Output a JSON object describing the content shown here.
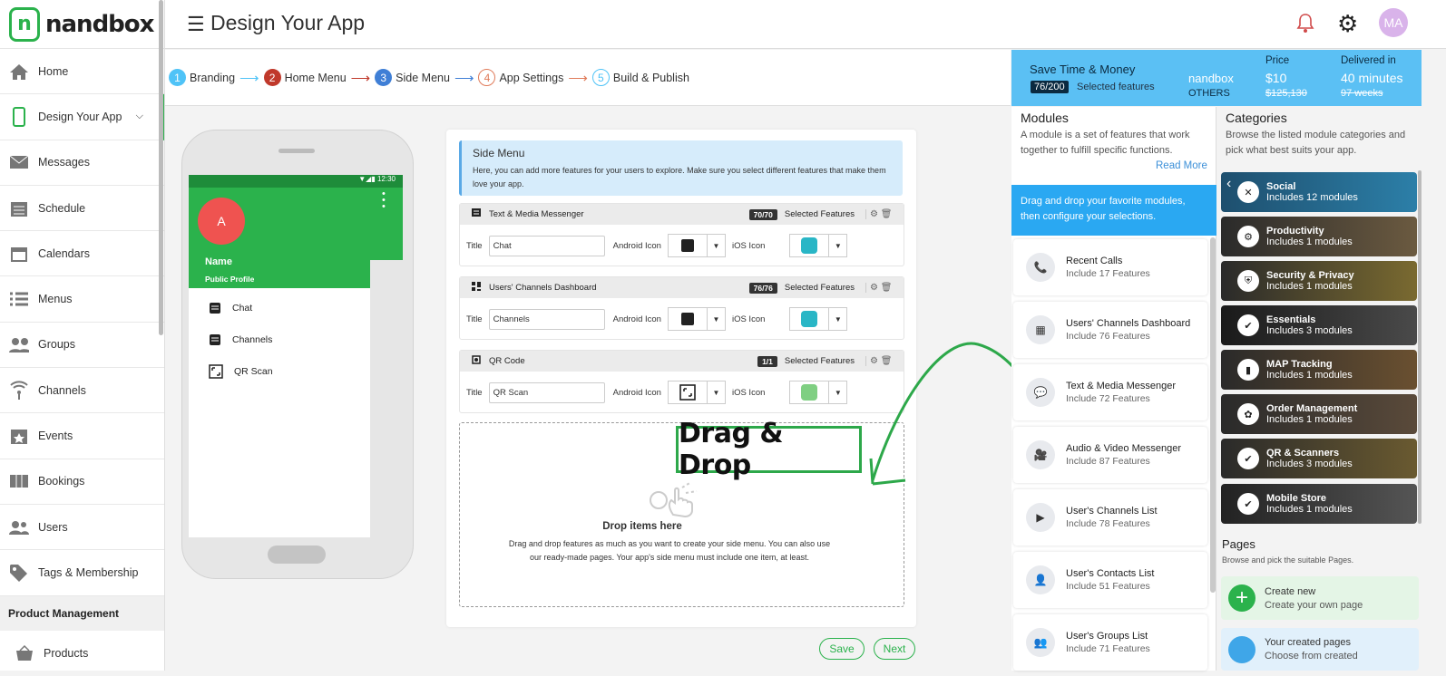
{
  "app": {
    "logo_mark": "n",
    "logo_text": "nandbox",
    "page_title": "Design Your App",
    "avatar_initials": "MA"
  },
  "sidebar": {
    "items": [
      {
        "label": "Home",
        "icon": "home-icon"
      },
      {
        "label": "Design Your App",
        "icon": "phone-icon",
        "active": true
      },
      {
        "label": "Messages",
        "icon": "envelope-icon"
      },
      {
        "label": "Schedule",
        "icon": "schedule-icon"
      },
      {
        "label": "Calendars",
        "icon": "calendar-icon"
      },
      {
        "label": "Menus",
        "icon": "list-icon"
      },
      {
        "label": "Groups",
        "icon": "groups-icon"
      },
      {
        "label": "Channels",
        "icon": "broadcast-icon"
      },
      {
        "label": "Events",
        "icon": "event-icon"
      },
      {
        "label": "Bookings",
        "icon": "booking-icon"
      },
      {
        "label": "Users",
        "icon": "users-icon"
      },
      {
        "label": "Tags & Membership",
        "icon": "tag-icon"
      }
    ],
    "section": "Product Management",
    "section_items": [
      {
        "label": "Products",
        "icon": "basket-icon"
      }
    ]
  },
  "steps": [
    {
      "num": "1",
      "label": "Branding",
      "color": "#4fc3f7"
    },
    {
      "num": "2",
      "label": "Home Menu",
      "color": "#c0392b"
    },
    {
      "num": "3",
      "label": "Side Menu",
      "color": "#3f7fd6"
    },
    {
      "num": "4",
      "label": "App Settings",
      "color": "#e07b5a"
    },
    {
      "num": "5",
      "label": "Build & Publish",
      "color": "#4fc3f7"
    }
  ],
  "phone": {
    "time": "12:30",
    "avatar": "A",
    "name": "Name",
    "profile": "Public Profile",
    "items": [
      "Chat",
      "Channels",
      "QR Scan"
    ]
  },
  "editor": {
    "intro_title": "Side Menu",
    "intro_desc": "Here, you can add more features for your users to explore. Make sure you select different features that make them love your app.",
    "selected_label": "Selected Features",
    "title_label": "Title",
    "android_label": "Android Icon",
    "ios_label": "iOS Icon",
    "features": [
      {
        "name": "Text & Media Messenger",
        "count": "70/70",
        "title": "Chat"
      },
      {
        "name": "Users' Channels Dashboard",
        "count": "76/76",
        "title": "Channels"
      },
      {
        "name": "QR Code",
        "count": "1/1",
        "title": "QR Scan"
      }
    ],
    "drop_title": "Drop items here",
    "drop_desc": "Drag and drop features as much as you want to create your side menu. You can also use our ready-made pages. Your app's side menu must include one item, at least.",
    "annotation": "Drag  & Drop",
    "save": "Save",
    "next": "Next"
  },
  "promo": {
    "title": "Save Time & Money",
    "count": "76/200",
    "count_label": "Selected features",
    "nandbox": "nandbox",
    "others": "OTHERS",
    "price_label": "Price",
    "price": "$10",
    "price_others": "$125,130",
    "delivered_label": "Delivered in",
    "delivered": "40 minutes",
    "delivered_others": "97 weeks"
  },
  "modules": {
    "title": "Modules",
    "desc": "A module is a set of features that work together to fulfill specific functions.",
    "read_more": "Read More",
    "info": "Drag and drop your favorite modules, then configure your selections.",
    "items": [
      {
        "name": "Recent Calls",
        "features": "Include 17 Features",
        "icon": "phone-call-icon"
      },
      {
        "name": "Users' Channels Dashboard",
        "features": "Include 76 Features",
        "icon": "dashboard-icon"
      },
      {
        "name": "Text & Media Messenger",
        "features": "Include 72 Features",
        "icon": "message-icon"
      },
      {
        "name": "Audio & Video Messenger",
        "features": "Include 87 Features",
        "icon": "video-icon"
      },
      {
        "name": "User's Channels List",
        "features": "Include 78 Features",
        "icon": "channel-list-icon"
      },
      {
        "name": "User's Contacts List",
        "features": "Include 51 Features",
        "icon": "contact-icon"
      },
      {
        "name": "User's Groups List",
        "features": "Include 71 Features",
        "icon": "group-icon"
      }
    ]
  },
  "categories": {
    "title": "Categories",
    "desc": "Browse the listed module categories and pick what best suits your app.",
    "items": [
      {
        "name": "Social",
        "modules": "Includes 12 modules",
        "icon": "social-icon"
      },
      {
        "name": "Productivity",
        "modules": "Includes 1 modules",
        "icon": "productivity-icon"
      },
      {
        "name": "Security & Privacy",
        "modules": "Includes 1 modules",
        "icon": "shield-icon"
      },
      {
        "name": "Essentials",
        "modules": "Includes 3 modules",
        "icon": "check-icon"
      },
      {
        "name": "MAP Tracking",
        "modules": "Includes 1 modules",
        "icon": "map-icon"
      },
      {
        "name": "Order Management",
        "modules": "Includes 1 modules",
        "icon": "order-icon"
      },
      {
        "name": "QR & Scanners",
        "modules": "Includes 3 modules",
        "icon": "check-icon"
      },
      {
        "name": "Mobile Store",
        "modules": "Includes 1 modules",
        "icon": "check-icon"
      }
    ]
  },
  "pages": {
    "title": "Pages",
    "desc": "Browse and pick the suitable Pages.",
    "items": [
      {
        "name": "Create new",
        "sub": "Create your own page"
      },
      {
        "name": "Your created pages",
        "sub": "Choose from created"
      }
    ]
  }
}
